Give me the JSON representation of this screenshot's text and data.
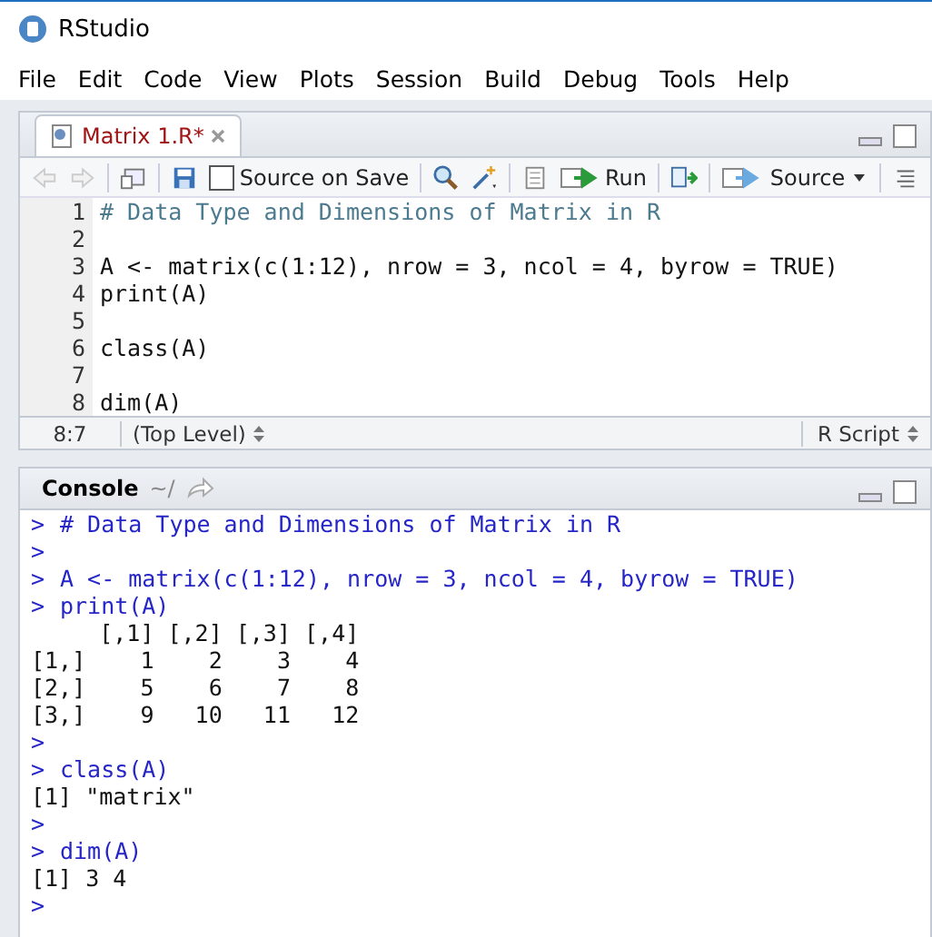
{
  "window": {
    "title": "RStudio"
  },
  "menu": [
    "File",
    "Edit",
    "Code",
    "View",
    "Plots",
    "Session",
    "Build",
    "Debug",
    "Tools",
    "Help"
  ],
  "editor": {
    "tab": {
      "label": "Matrix 1.R*",
      "selected": true
    },
    "toolbar": {
      "source_on_save": {
        "label": "Source on Save",
        "checked": false
      },
      "run": "Run",
      "source": "Source"
    },
    "lines": [
      {
        "number": "1",
        "kind": "comment",
        "text": "# Data Type and Dimensions of Matrix in R"
      },
      {
        "number": "2"
      },
      {
        "number": "3",
        "kind": "code",
        "text": "A <- matrix(c(1:12), nrow = 3, ncol = 4, byrow = TRUE)"
      },
      {
        "number": "4",
        "kind": "code",
        "text": "print(A)"
      },
      {
        "number": "5"
      },
      {
        "number": "6",
        "kind": "code",
        "text": "class(A)"
      },
      {
        "number": "7"
      },
      {
        "number": "8",
        "kind": "code",
        "text": "dim(A)"
      }
    ],
    "status": {
      "position": "8:7",
      "scope": "(Top Level)",
      "file_type": "R Script"
    }
  },
  "console": {
    "title": "Console",
    "path": "~/",
    "lines": [
      {
        "kind": "input",
        "prompt": ">",
        "text": "# Data Type and Dimensions of Matrix in R"
      },
      {
        "kind": "input",
        "prompt": ">"
      },
      {
        "kind": "input",
        "prompt": ">",
        "text": "A <- matrix(c(1:12), nrow = 3, ncol = 4, byrow = TRUE)"
      },
      {
        "kind": "input",
        "prompt": ">",
        "text": "print(A)"
      },
      {
        "kind": "output",
        "text": "     [,1] [,2] [,3] [,4]"
      },
      {
        "kind": "output",
        "text": "[1,]    1    2    3    4"
      },
      {
        "kind": "output",
        "text": "[2,]    5    6    7    8"
      },
      {
        "kind": "output",
        "text": "[3,]    9   10   11   12"
      },
      {
        "kind": "input",
        "prompt": ">"
      },
      {
        "kind": "input",
        "prompt": ">",
        "text": "class(A)"
      },
      {
        "kind": "output",
        "text": "[1] \"matrix\""
      },
      {
        "kind": "input",
        "prompt": ">"
      },
      {
        "kind": "input",
        "prompt": ">",
        "text": "dim(A)"
      },
      {
        "kind": "output",
        "text": "[1] 3 4"
      },
      {
        "kind": "input",
        "prompt": ">"
      }
    ]
  }
}
